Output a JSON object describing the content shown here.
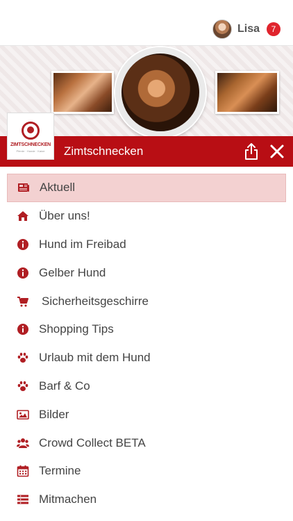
{
  "user": {
    "name": "Lisa",
    "badge_count": "7"
  },
  "header": {
    "title": "Zimtschnecken"
  },
  "logo": {
    "text": "ZIMTSCHNECKEN",
    "subtext": "Pferde · Hunde · Katze"
  },
  "colors": {
    "brand_red": "#b80e14",
    "active_bg": "#f3d1d1",
    "icon_red": "#b01e23",
    "badge_red": "#e0242d"
  },
  "menu": {
    "items": [
      {
        "label": "Aktuell",
        "icon": "newspaper-icon",
        "active": true
      },
      {
        "label": "Über uns!",
        "icon": "home-icon"
      },
      {
        "label": "Hund im Freibad",
        "icon": "info-icon"
      },
      {
        "label": "Gelber Hund",
        "icon": "info-icon"
      },
      {
        "label": "Sicherheitsgeschirre",
        "icon": "cart-icon"
      },
      {
        "label": "Shopping Tips",
        "icon": "info-icon"
      },
      {
        "label": "Urlaub mit dem Hund",
        "icon": "paw-icon"
      },
      {
        "label": "Barf & Co",
        "icon": "paw-icon"
      },
      {
        "label": "Bilder",
        "icon": "image-icon"
      },
      {
        "label": "Crowd Collect BETA",
        "icon": "users-icon"
      },
      {
        "label": "Termine",
        "icon": "calendar-icon"
      },
      {
        "label": "Mitmachen",
        "icon": "list-icon"
      }
    ]
  }
}
